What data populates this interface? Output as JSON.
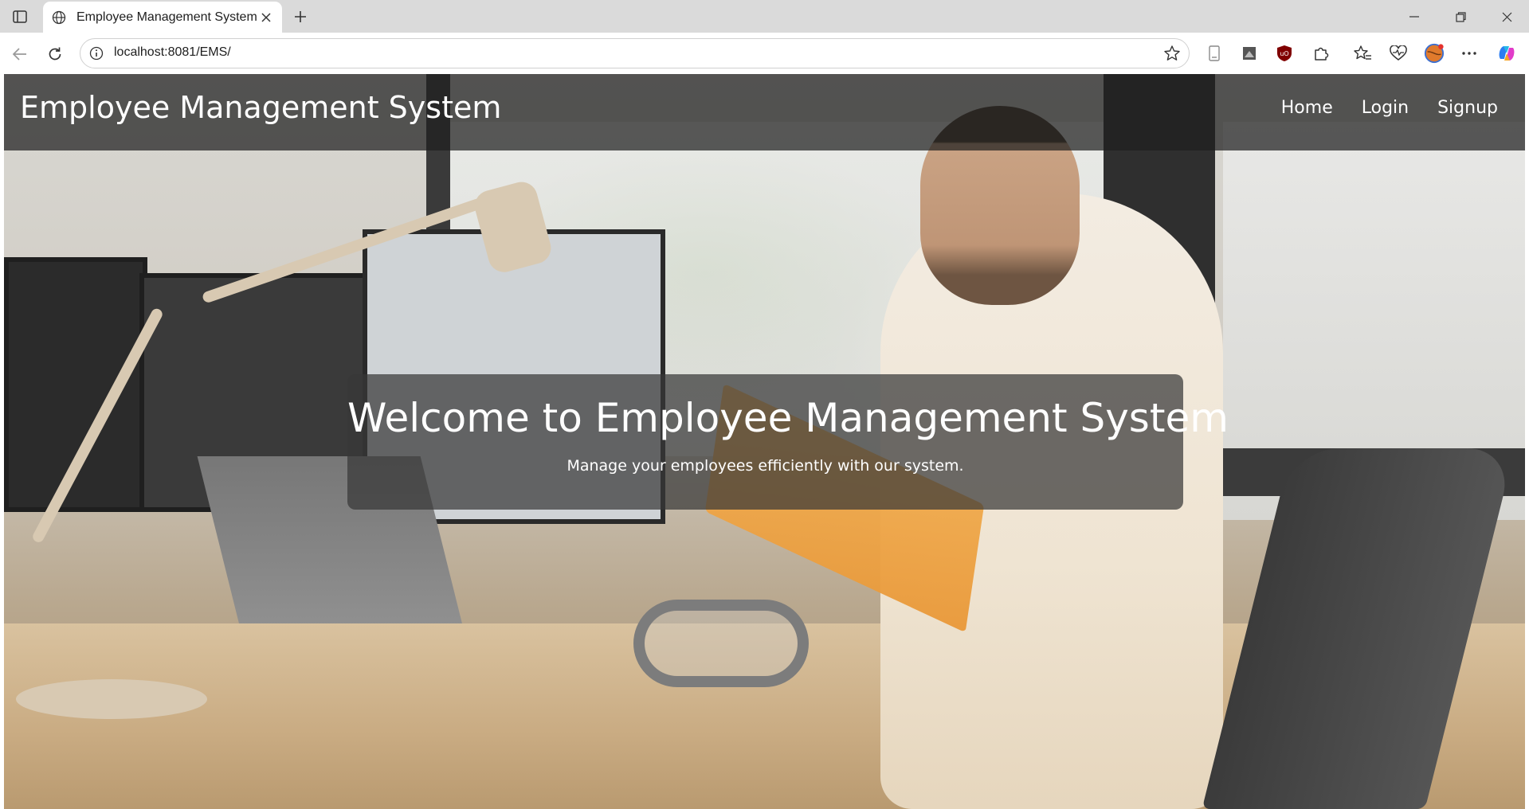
{
  "browser": {
    "tab": {
      "title": "Employee Management System",
      "favicon": "globe-icon"
    },
    "address": {
      "url": "localhost:8081/EMS/"
    },
    "icons": {
      "sidebar": "tab-sidebar-icon",
      "close": "close-icon",
      "new_tab": "plus-icon",
      "back": "back-arrow-icon",
      "reload": "reload-icon",
      "info": "info-icon",
      "favorite": "star-icon",
      "extensions": [
        "reading-view-icon",
        "bookmark-icon",
        "ublock-icon",
        "puzzle-icon",
        "favorites-icon",
        "health-icon",
        "profile-avatar-icon",
        "more-icon",
        "copilot-icon"
      ],
      "window": [
        "minimize-icon",
        "restore-icon",
        "window-close-icon"
      ]
    }
  },
  "site": {
    "brand": "Employee Management System",
    "nav": [
      {
        "label": "Home"
      },
      {
        "label": "Login"
      },
      {
        "label": "Signup"
      }
    ],
    "hero": {
      "title": "Welcome to Employee Management System",
      "subtitle": "Manage your employees efficiently with our system."
    }
  },
  "colors": {
    "navbar_bg": "#1e1e1e",
    "text": "#ffffff",
    "tabstrip": "#dadada"
  }
}
